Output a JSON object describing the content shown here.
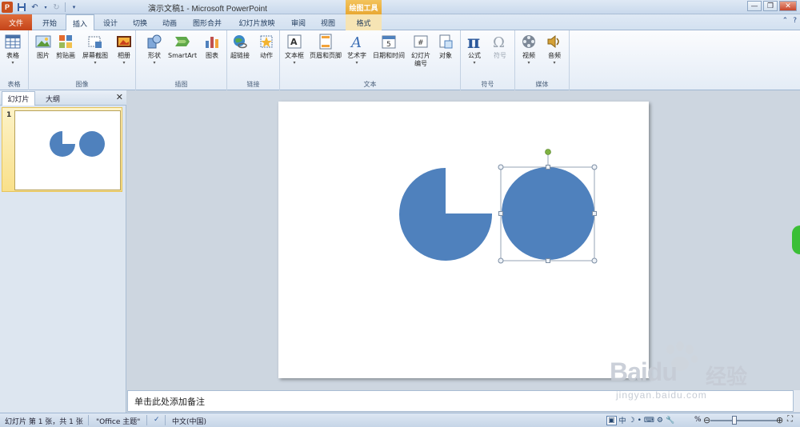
{
  "window": {
    "title": "演示文稿1 - Microsoft PowerPoint",
    "context_tool": "绘图工具",
    "app_logo": "P",
    "controls": [
      "—",
      "❐",
      "✕"
    ]
  },
  "qat": {
    "save_icon": "save-icon",
    "undo_icon": "undo-icon",
    "redo_icon": "redo-icon"
  },
  "tabs": [
    {
      "label": "文件",
      "id": "file"
    },
    {
      "label": "开始",
      "id": "home"
    },
    {
      "label": "插入",
      "id": "insert"
    },
    {
      "label": "设计",
      "id": "design"
    },
    {
      "label": "切换",
      "id": "transitions"
    },
    {
      "label": "动画",
      "id": "animations"
    },
    {
      "label": "图形合并",
      "id": "merge-shapes"
    },
    {
      "label": "幻灯片放映",
      "id": "slideshow"
    },
    {
      "label": "审阅",
      "id": "review"
    },
    {
      "label": "视图",
      "id": "view"
    },
    {
      "label": "格式",
      "id": "format"
    }
  ],
  "active_tab": "插入",
  "ribbon": {
    "groups": [
      {
        "label": "表格",
        "buttons": [
          {
            "label": "表格"
          }
        ]
      },
      {
        "label": "图像",
        "buttons": [
          {
            "label": "图片"
          },
          {
            "label": "剪贴画"
          },
          {
            "label": "屏幕截图"
          },
          {
            "label": "相册"
          }
        ]
      },
      {
        "label": "插图",
        "buttons": [
          {
            "label": "形状"
          },
          {
            "label": "SmartArt"
          },
          {
            "label": "图表"
          }
        ]
      },
      {
        "label": "链接",
        "buttons": [
          {
            "label": "超链接"
          },
          {
            "label": "动作"
          }
        ]
      },
      {
        "label": "文本",
        "buttons": [
          {
            "label": "文本框"
          },
          {
            "label": "页眉和页脚"
          },
          {
            "label": "艺术字"
          },
          {
            "label": "日期和时间"
          },
          {
            "label": "幻灯片",
            "label2": "编号"
          },
          {
            "label": "对象"
          }
        ]
      },
      {
        "label": "符号",
        "buttons": [
          {
            "label": "公式"
          },
          {
            "label": "符号"
          }
        ]
      },
      {
        "label": "媒体",
        "buttons": [
          {
            "label": "视频"
          },
          {
            "label": "音频"
          }
        ]
      }
    ]
  },
  "panel": {
    "tabs": [
      "幻灯片",
      "大纲"
    ],
    "close": "✕",
    "slide_number": "1"
  },
  "slide": {
    "accent_color": "#4f81bd",
    "handle_color": "#7fb241"
  },
  "notes": {
    "placeholder": "单击此处添加备注"
  },
  "status": {
    "slide_info": "幻灯片 第 1 张，共 1 张",
    "theme": "\"Office 主题\"",
    "language": "中文(中国)",
    "zoom_fragment": "%",
    "view_ime": "中"
  },
  "watermark": {
    "brand": "Bai",
    "brand2": "du",
    "cn": "经验",
    "url": "jingyan.baidu.com"
  }
}
